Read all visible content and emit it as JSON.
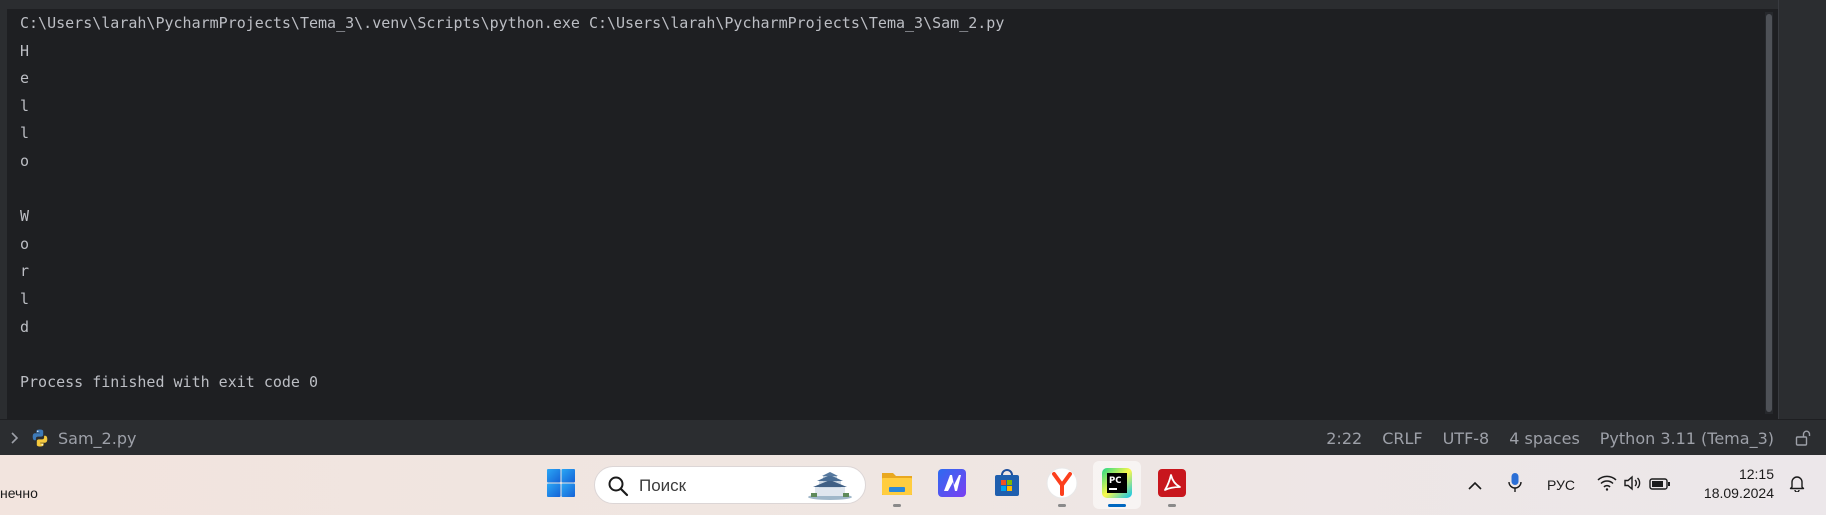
{
  "console": {
    "lines": [
      "C:\\Users\\larah\\PycharmProjects\\Tema_3\\.venv\\Scripts\\python.exe C:\\Users\\larah\\PycharmProjects\\Tema_3\\Sam_2.py",
      "H",
      "e",
      "l",
      "l",
      "o",
      "",
      "W",
      "o",
      "r",
      "l",
      "d",
      "",
      "Process finished with exit code 0"
    ]
  },
  "statusbar": {
    "file_name": "Sam_2.py",
    "position": "2:22",
    "line_ending": "CRLF",
    "encoding": "UTF-8",
    "indent": "4 spaces",
    "interpreter": "Python 3.11 (Tema_3)"
  },
  "taskbar": {
    "weather_text": "нечно",
    "search_placeholder": "Поиск",
    "language": "РУС",
    "time": "12:15",
    "date": "18.09.2024",
    "apps": [
      {
        "icon": "start-icon"
      },
      {
        "icon": "file-explorer-icon"
      },
      {
        "icon": "maple-app-icon"
      },
      {
        "icon": "microsoft-store-icon"
      },
      {
        "icon": "yandex-browser-icon"
      },
      {
        "icon": "pycharm-icon"
      },
      {
        "icon": "acrobat-reader-icon"
      }
    ]
  },
  "colors": {
    "console_bg": "#1e1f22",
    "console_text": "#bcbec4",
    "statusbar_bg": "#2b2d30",
    "accent": "#0067c0"
  }
}
